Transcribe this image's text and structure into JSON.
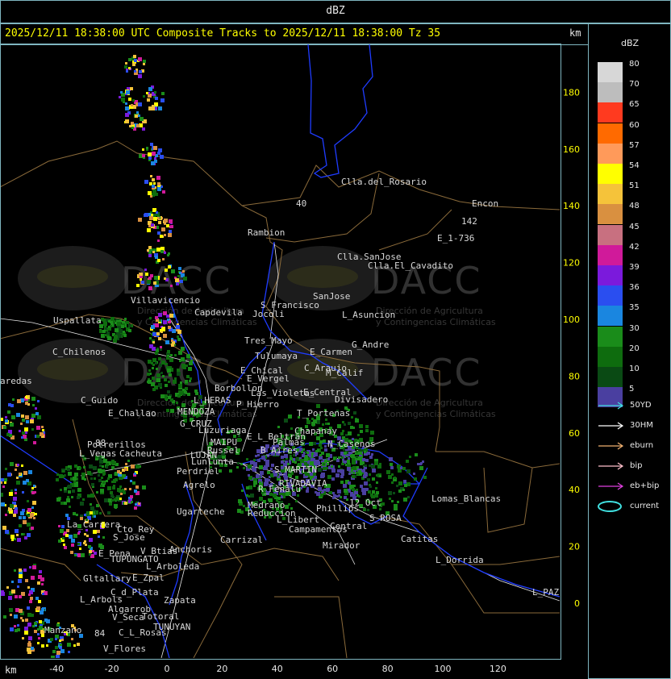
{
  "header": {
    "product": "dBZ",
    "run_title": "2025/12/11 18:38:00 UTC Composite Tracks to 2025/12/11 18:38:00 Tz 35",
    "km_top": "km",
    "km_bottom": "km"
  },
  "axes": {
    "x_ticks": [
      "-40",
      "-20",
      "0",
      "20",
      "40",
      "60",
      "80",
      "100",
      "120"
    ],
    "y_ticks": [
      "180",
      "160",
      "140",
      "120",
      "100",
      "80",
      "60",
      "40",
      "20",
      "0"
    ]
  },
  "legend": {
    "title": "dBZ",
    "scale": [
      {
        "value": "80",
        "color": "#d7d7d7"
      },
      {
        "value": "70",
        "color": "#bdbdbd"
      },
      {
        "value": "65",
        "color": "#ff3a1f"
      },
      {
        "value": "60",
        "color": "#ff6a00"
      },
      {
        "value": "57",
        "color": "#ff9a5a"
      },
      {
        "value": "54",
        "color": "#ffff00"
      },
      {
        "value": "51",
        "color": "#f5c33a"
      },
      {
        "value": "48",
        "color": "#d99040"
      },
      {
        "value": "45",
        "color": "#c87080"
      },
      {
        "value": "42",
        "color": "#d01a9a"
      },
      {
        "value": "39",
        "color": "#7b1adc"
      },
      {
        "value": "36",
        "color": "#2a4ef0"
      },
      {
        "value": "35",
        "color": "#1a86e0"
      },
      {
        "value": "30",
        "color": "#1a8c1a"
      },
      {
        "value": "20",
        "color": "#0e6c0e"
      },
      {
        "value": "10",
        "color": "#0a4a14"
      },
      {
        "value": "5",
        "color": "#4a3fa0"
      }
    ],
    "tracks": [
      {
        "label": "50YD",
        "color": "#40e0e0"
      },
      {
        "label": "30HM",
        "color": "#ffffff"
      },
      {
        "label": "eburn",
        "color": "#f0b070"
      },
      {
        "label": "bip",
        "color": "#ffc0cb"
      },
      {
        "label": "eb+bip",
        "color": "#e040e0"
      },
      {
        "label": "current",
        "color": "#40e0e0"
      }
    ]
  },
  "watermark": {
    "brand": "DACC",
    "line1": "Dirección de Agricultura",
    "line2": "y Contingencias Climáticas"
  },
  "places": [
    {
      "name": "Clla.del_Rosario"
    },
    {
      "name": "Encon"
    },
    {
      "name": "142"
    },
    {
      "name": "E_1-736"
    },
    {
      "name": "Rambion"
    },
    {
      "name": "Clla.SanJose"
    },
    {
      "name": "Clla.El_Cavadito"
    },
    {
      "name": "Villavicencio"
    },
    {
      "name": "S_Francisco"
    },
    {
      "name": "SanJose"
    },
    {
      "name": "Capdevila"
    },
    {
      "name": "Jocoli"
    },
    {
      "name": "L_Asuncion"
    },
    {
      "name": "Uspallata"
    },
    {
      "name": "Tres_Mayo"
    },
    {
      "name": "G_Andre"
    },
    {
      "name": "C_Chilenos"
    },
    {
      "name": "Tulumaya"
    },
    {
      "name": "E_Carmen"
    },
    {
      "name": "C_Araujo"
    },
    {
      "name": "E_Chical"
    },
    {
      "name": "M_Calif"
    },
    {
      "name": "aredas"
    },
    {
      "name": "E_Vergel"
    },
    {
      "name": "Borbollon"
    },
    {
      "name": "E_Central"
    },
    {
      "name": "Divisadero"
    },
    {
      "name": "C_Guido"
    },
    {
      "name": "L_HERAS"
    },
    {
      "name": "Las_Violetas"
    },
    {
      "name": "P_Hierro"
    },
    {
      "name": "MENDOZA"
    },
    {
      "name": "E_Challao"
    },
    {
      "name": "T_Portenas"
    },
    {
      "name": "G_CRUZ"
    },
    {
      "name": "Luzuriaga"
    },
    {
      "name": "Chapanay"
    },
    {
      "name": "E_L_Beltran"
    },
    {
      "name": "B_Aires"
    },
    {
      "name": "Palmas"
    },
    {
      "name": "N_Casenos"
    },
    {
      "name": "Russel"
    },
    {
      "name": "MAIPU"
    },
    {
      "name": "Potrerillos"
    },
    {
      "name": "LUJAN"
    },
    {
      "name": "Cacheuta"
    },
    {
      "name": "Lunlunta"
    },
    {
      "name": "L_Vegas"
    },
    {
      "name": "Perdriel"
    },
    {
      "name": "S_MARTIN"
    },
    {
      "name": "RIVADAVIA"
    },
    {
      "name": "Agrelo"
    },
    {
      "name": "R_Fenalu"
    },
    {
      "name": "Lomas_Blancas"
    },
    {
      "name": "12_Oct"
    },
    {
      "name": "Ugarteche"
    },
    {
      "name": "Medrano"
    },
    {
      "name": "Reduccion"
    },
    {
      "name": "Phillips"
    },
    {
      "name": "L_Libert"
    },
    {
      "name": "S_ROSA"
    },
    {
      "name": "La_Carrera"
    },
    {
      "name": "Cto_Rey"
    },
    {
      "name": "Campamentos"
    },
    {
      "name": "Central"
    },
    {
      "name": "S_Jose"
    },
    {
      "name": "Carrizal"
    },
    {
      "name": "Catitas"
    },
    {
      "name": "Anchoris"
    },
    {
      "name": "E_Pena"
    },
    {
      "name": "V_Btias"
    },
    {
      "name": "Mirador"
    },
    {
      "name": "TUPUNGATO"
    },
    {
      "name": "L_Dorrida"
    },
    {
      "name": "L_Arboleda"
    },
    {
      "name": "Gltallary"
    },
    {
      "name": "E_Zpal"
    },
    {
      "name": "C_d_Plata"
    },
    {
      "name": "L_Arbols"
    },
    {
      "name": "Zapata"
    },
    {
      "name": "Algarrob"
    },
    {
      "name": "V_Seca"
    },
    {
      "name": "Totoral"
    },
    {
      "name": "TUNUYAN"
    },
    {
      "name": "Manzano"
    },
    {
      "name": "C_L_Rosas"
    },
    {
      "name": "V_Flores"
    },
    {
      "name": "L_PAZ"
    },
    {
      "name": "40"
    },
    {
      "name": "88"
    },
    {
      "name": "84"
    }
  ]
}
